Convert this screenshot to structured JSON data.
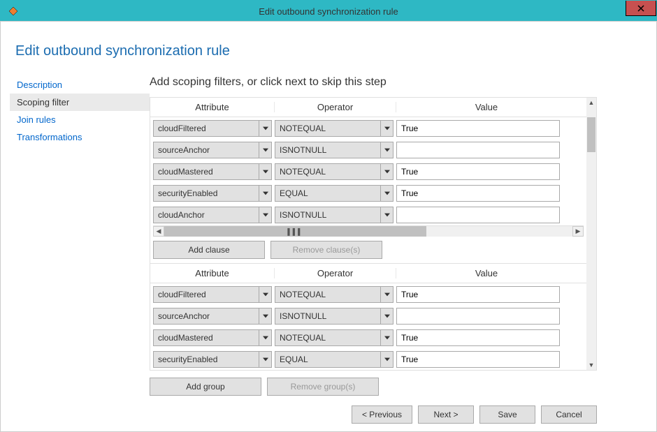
{
  "titlebar": {
    "title": "Edit outbound synchronization rule"
  },
  "heading": "Edit outbound synchronization rule",
  "sidebar": {
    "items": [
      {
        "label": "Description"
      },
      {
        "label": "Scoping filter"
      },
      {
        "label": "Join rules"
      },
      {
        "label": "Transformations"
      }
    ],
    "selected_index": 1
  },
  "content": {
    "step_title": "Add scoping filters, or click next to skip this step",
    "columns": {
      "attribute": "Attribute",
      "operator": "Operator",
      "value": "Value"
    },
    "groups": [
      {
        "clauses": [
          {
            "attribute": "cloudFiltered",
            "operator": "NOTEQUAL",
            "value": "True"
          },
          {
            "attribute": "sourceAnchor",
            "operator": "ISNOTNULL",
            "value": ""
          },
          {
            "attribute": "cloudMastered",
            "operator": "NOTEQUAL",
            "value": "True"
          },
          {
            "attribute": "securityEnabled",
            "operator": "EQUAL",
            "value": "True"
          },
          {
            "attribute": "cloudAnchor",
            "operator": "ISNOTNULL",
            "value": ""
          }
        ]
      },
      {
        "clauses": [
          {
            "attribute": "cloudFiltered",
            "operator": "NOTEQUAL",
            "value": "True"
          },
          {
            "attribute": "sourceAnchor",
            "operator": "ISNOTNULL",
            "value": ""
          },
          {
            "attribute": "cloudMastered",
            "operator": "NOTEQUAL",
            "value": "True"
          },
          {
            "attribute": "securityEnabled",
            "operator": "EQUAL",
            "value": "True"
          }
        ]
      }
    ],
    "buttons": {
      "add_clause": "Add clause",
      "remove_clause": "Remove clause(s)",
      "add_group": "Add group",
      "remove_group": "Remove group(s)"
    }
  },
  "footer": {
    "previous": "< Previous",
    "next": "Next >",
    "save": "Save",
    "cancel": "Cancel"
  }
}
